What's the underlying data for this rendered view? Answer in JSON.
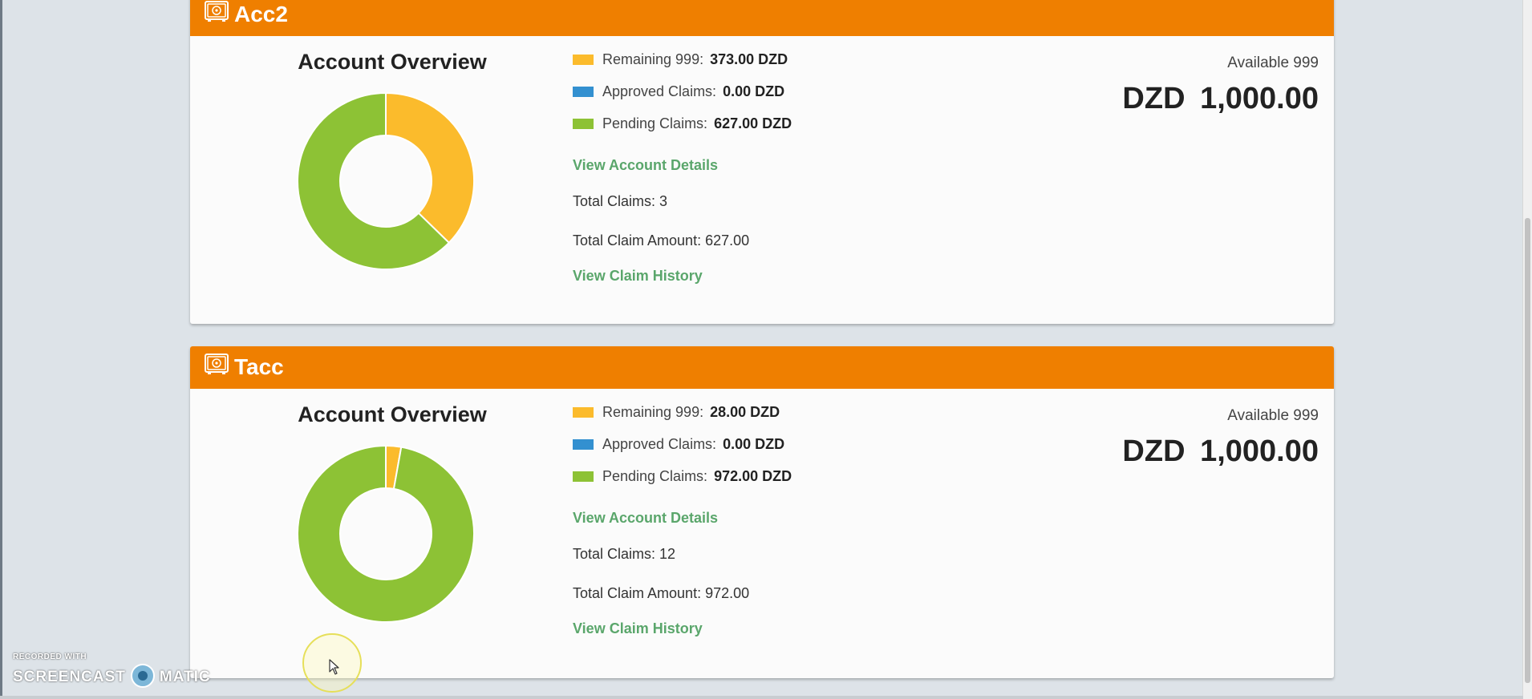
{
  "accounts": [
    {
      "name": "Acc2",
      "overview_title": "Account Overview",
      "legend": [
        {
          "label": "Remaining 999:",
          "value": "373.00 DZD",
          "color": "#fbbb2c"
        },
        {
          "label": "Approved Claims:",
          "value": "0.00 DZD",
          "color": "#3390d0"
        },
        {
          "label": "Pending Claims:",
          "value": "627.00 DZD",
          "color": "#8dc235"
        }
      ],
      "view_account_details": "View Account Details",
      "total_claims": "Total Claims: 3",
      "total_claim_amount": "Total Claim Amount: 627.00",
      "view_claim_history": "View Claim History",
      "available_label": "Available 999",
      "available_amount": "DZD  1,000.00"
    },
    {
      "name": "Tacc",
      "overview_title": "Account Overview",
      "legend": [
        {
          "label": "Remaining 999:",
          "value": "28.00 DZD",
          "color": "#fbbb2c"
        },
        {
          "label": "Approved Claims:",
          "value": "0.00 DZD",
          "color": "#3390d0"
        },
        {
          "label": "Pending Claims:",
          "value": "972.00 DZD",
          "color": "#8dc235"
        }
      ],
      "view_account_details": "View Account Details",
      "total_claims": "Total Claims: 12",
      "total_claim_amount": "Total Claim Amount: 972.00",
      "view_claim_history": "View Claim History",
      "available_label": "Available 999",
      "available_amount": "DZD  1,000.00"
    }
  ],
  "chart_data": [
    {
      "type": "pie",
      "categories": [
        "Remaining 999",
        "Approved Claims",
        "Pending Claims"
      ],
      "values": [
        373.0,
        0.0,
        627.0
      ],
      "colors": [
        "#fbbb2c",
        "#3390d0",
        "#8dc235"
      ],
      "donut": true
    },
    {
      "type": "pie",
      "categories": [
        "Remaining 999",
        "Approved Claims",
        "Pending Claims"
      ],
      "values": [
        28.0,
        0.0,
        972.0
      ],
      "colors": [
        "#fbbb2c",
        "#3390d0",
        "#8dc235"
      ],
      "donut": true
    }
  ],
  "watermark": {
    "top_text": "RECORDED WITH",
    "left_text": "SCREENCAST",
    "right_text": "MATIC"
  },
  "colors": {
    "header": "#ef7f00",
    "link": "#5aa66b"
  }
}
